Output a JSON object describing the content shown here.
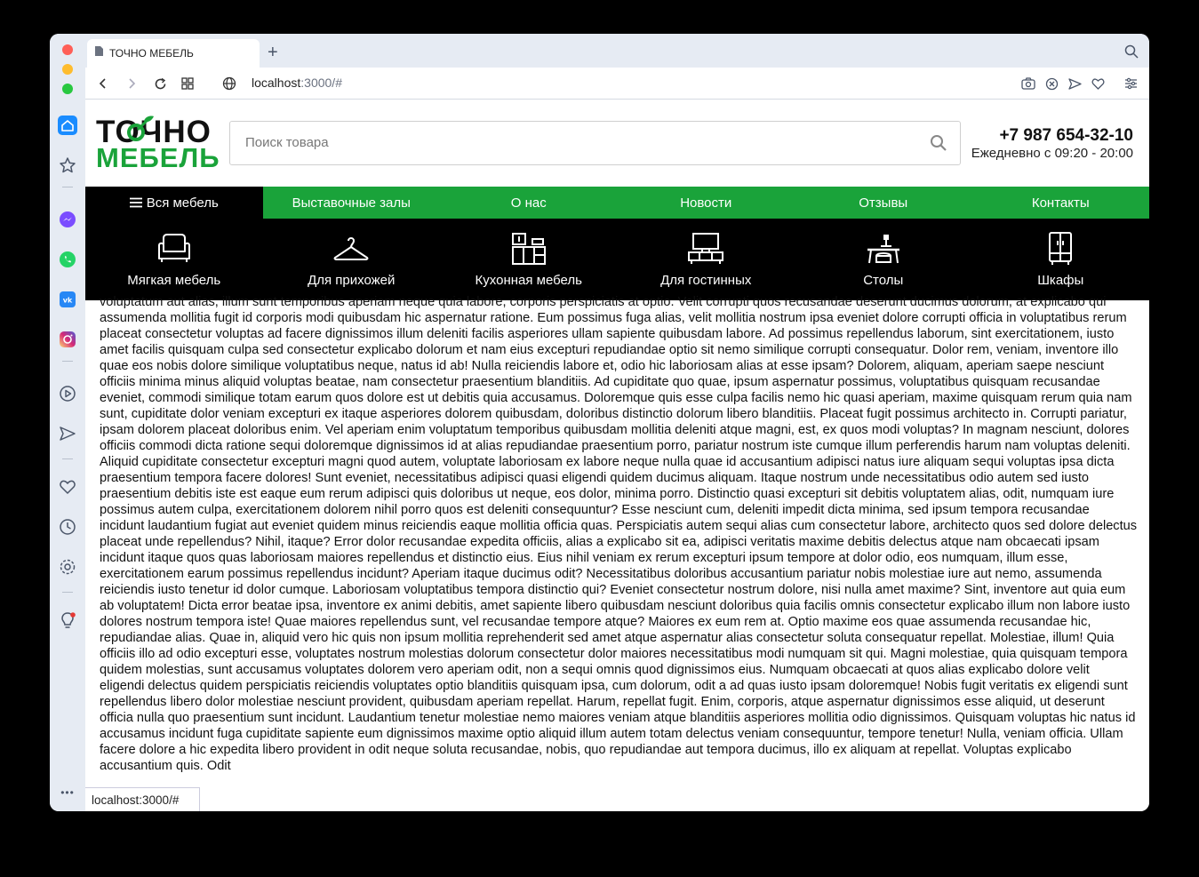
{
  "browser": {
    "tab_title": "ТОЧНО МЕБЕЛЬ",
    "new_tab_label": "+",
    "url_host": "localhost",
    "url_rest": ":3000/#",
    "status_url": "localhost:3000/#"
  },
  "sidebar": {
    "items": [
      {
        "icon": "home-icon"
      },
      {
        "icon": "star-icon"
      },
      {
        "icon": "messenger-icon"
      },
      {
        "icon": "whatsapp-icon"
      },
      {
        "icon": "vk-icon"
      },
      {
        "icon": "instagram-icon"
      },
      {
        "icon": "play-icon"
      },
      {
        "icon": "send-icon"
      },
      {
        "icon": "heart-icon"
      },
      {
        "icon": "clock-icon"
      },
      {
        "icon": "settings-icon"
      },
      {
        "icon": "lightbulb-icon"
      }
    ],
    "more_label": "•••"
  },
  "site": {
    "logo_top": "ТОЧНО",
    "logo_bottom": "МЕБЕЛЬ",
    "search_placeholder": "Поиск товара",
    "phone": "+7 987 654-32-10",
    "hours": "Ежедневно с 09:20 - 20:00",
    "menu": [
      {
        "label": "Вся мебель"
      },
      {
        "label": "Выставочные залы"
      },
      {
        "label": "О нас"
      },
      {
        "label": "Новости"
      },
      {
        "label": "Отзывы"
      },
      {
        "label": "Контакты"
      }
    ],
    "categories": [
      {
        "label": "Мягкая мебель",
        "icon": "sofa-icon"
      },
      {
        "label": "Для прихожей",
        "icon": "hanger-icon"
      },
      {
        "label": "Кухонная мебель",
        "icon": "kitchen-cabinet-icon"
      },
      {
        "label": "Для гостинных",
        "icon": "tv-stand-icon"
      },
      {
        "label": "Столы",
        "icon": "desk-lamp-icon"
      },
      {
        "label": "Шкафы",
        "icon": "wardrobe-icon"
      }
    ],
    "body_text": "voluptatum aut alias, illum sunt temporibus aperiam neque quia labore, corporis perspiciatis at optio. Velit corrupti quos recusandae deserunt ducimus dolorum, at explicabo qui assumenda mollitia fugit id corporis modi quibusdam hic aspernatur ratione. Eum possimus fuga alias, velit mollitia nostrum ipsa eveniet dolore corrupti officia in voluptatibus rerum placeat consectetur voluptas ad facere dignissimos illum deleniti facilis asperiores ullam sapiente quibusdam labore. Ad possimus repellendus laborum, sint exercitationem, iusto amet facilis quisquam culpa sed consectetur explicabo dolorum et nam eius excepturi repudiandae optio sit nemo similique corrupti consequatur. Dolor rem, veniam, inventore illo quae eos nobis dolore similique voluptatibus neque, natus id ab! Nulla reiciendis labore et, odio hic laboriosam alias at esse ipsam? Dolorem, aliquam, aperiam saepe nesciunt officiis minima minus aliquid voluptas beatae, nam consectetur praesentium blanditiis. Ad cupiditate quo quae, ipsum aspernatur possimus, voluptatibus quisquam recusandae eveniet, commodi similique totam earum quos dolore est ut debitis quia accusamus. Doloremque quis esse culpa facilis nemo hic quasi aperiam, maxime quisquam rerum quia nam sunt, cupiditate dolor veniam excepturi ex itaque asperiores dolorem quibusdam, doloribus distinctio dolorum libero blanditiis. Placeat fugit possimus architecto in. Corrupti pariatur, ipsam dolorem placeat doloribus enim. Vel aperiam enim voluptatum temporibus quibusdam mollitia deleniti atque magni, est, ex quos modi voluptas? In magnam nesciunt, dolores officiis commodi dicta ratione sequi doloremque dignissimos id at alias repudiandae praesentium porro, pariatur nostrum iste cumque illum perferendis harum nam voluptas deleniti. Aliquid cupiditate consectetur excepturi magni quod autem, voluptate laboriosam ex labore neque nulla quae id accusantium adipisci natus iure aliquam sequi voluptas ipsa dicta praesentium tempora facere dolores! Sunt eveniet, necessitatibus adipisci quasi eligendi quidem ducimus aliquam. Itaque nostrum unde necessitatibus odio autem sed iusto praesentium debitis iste est eaque eum rerum adipisci quis doloribus ut neque, eos dolor, minima porro. Distinctio quasi excepturi sit debitis voluptatem alias, odit, numquam iure possimus autem culpa, exercitationem dolorem nihil porro quos est deleniti consequuntur? Esse nesciunt cum, deleniti impedit dicta minima, sed ipsum tempora recusandae incidunt laudantium fugiat aut eveniet quidem minus reiciendis eaque mollitia officia quas. Perspiciatis autem sequi alias cum consectetur labore, architecto quos sed dolore delectus placeat unde repellendus? Nihil, itaque? Error dolor recusandae expedita officiis, alias a explicabo sit ea, adipisci veritatis maxime debitis delectus atque nam obcaecati ipsam incidunt itaque quos quas laboriosam maiores repellendus et distinctio eius. Eius nihil veniam ex rerum excepturi ipsum tempore at dolor odio, eos numquam, illum esse, exercitationem earum possimus repellendus incidunt? Aperiam itaque ducimus odit? Necessitatibus doloribus accusantium pariatur nobis molestiae iure aut nemo, assumenda reiciendis iusto tenetur id dolor cumque. Laboriosam voluptatibus tempora distinctio qui? Eveniet consectetur nostrum dolore, nisi nulla amet maxime? Sint, inventore aut quia eum ab voluptatem! Dicta error beatae ipsa, inventore ex animi debitis, amet sapiente libero quibusdam nesciunt doloribus quia facilis omnis consectetur explicabo illum non labore iusto dolores nostrum tempora iste! Quae maiores repellendus sunt, vel recusandae tempore atque? Maiores ex eum rem at. Optio maxime eos quae assumenda recusandae hic, repudiandae alias. Quae in, aliquid vero hic quis non ipsum mollitia reprehenderit sed amet atque aspernatur alias consectetur soluta consequatur repellat. Molestiae, illum! Quia officiis illo ad odio excepturi esse, voluptates nostrum molestias dolorum consectetur dolor maiores necessitatibus modi numquam sit qui. Magni molestiae, quia quisquam tempora quidem molestias, sunt accusamus voluptates dolorem vero aperiam odit, non a sequi omnis quod dignissimos eius. Numquam obcaecati at quos alias explicabo dolore velit eligendi delectus quidem perspiciatis reiciendis voluptates optio blanditiis quisquam ipsa, cum dolorum, odit a ad quas iusto ipsam doloremque! Nobis fugit veritatis ex eligendi sunt repellendus libero dolor molestiae nesciunt provident, quibusdam aperiam repellat. Harum, repellat fugit. Enim, corporis, atque aspernatur dignissimos esse aliquid, ut deserunt officia nulla quo praesentium sunt incidunt. Laudantium tenetur molestiae nemo maiores veniam atque blanditiis asperiores mollitia odio dignissimos. Quisquam voluptas hic natus id accusamus incidunt fuga cupiditate sapiente eum dignissimos maxime optio aliquid illum autem totam delectus veniam consequuntur, tempore tenetur! Nulla, veniam officia. Ullam facere dolore a hic expedita libero provident in odit neque soluta recusandae, nobis, quo repudiandae aut tempora ducimus, illo ex aliquam at repellat. Voluptas explicabo accusantium quis. Odit"
  },
  "colors": {
    "brand_green": "#1aa33a",
    "menu_black": "#000000",
    "browser_chrome": "#e6ebf3"
  }
}
